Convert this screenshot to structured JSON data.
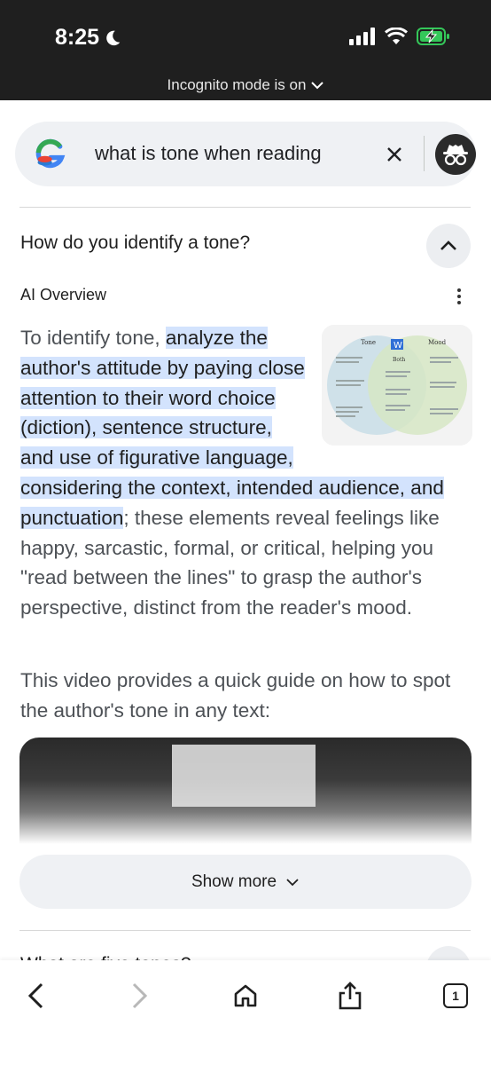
{
  "status_bar": {
    "time": "8:25"
  },
  "incognito": {
    "banner": "Incognito mode is on"
  },
  "search": {
    "query": "what is tone when reading"
  },
  "question": {
    "title": "How do you identify a tone?",
    "ai_label": "AI Overview"
  },
  "overview": {
    "intro": "To identify tone, ",
    "highlight": "analyze the author's attitude by paying close attention to their word choice (diction), sentence structure, and use of figurative language, considering the context, intended audience, and punctuation",
    "rest": "; these elements reveal feelings like happy, sarcastic, formal, or critical, helping you \"read between the lines\" to grasp the author's perspective, distinct from the reader's mood.",
    "video_intro": "This video provides a quick guide on how to spot the author's tone in any text:"
  },
  "venn": {
    "left": "Tone",
    "center": "Both",
    "right": "Mood",
    "badge": "W"
  },
  "show_more": {
    "label": "Show more"
  },
  "next_question": {
    "title": "What are five tones?"
  },
  "bottom_nav": {
    "tab_count": "1"
  },
  "colors": {
    "highlight": "#d3e3fd",
    "header_bg": "#1f1f1f",
    "pill_bg": "#eff1f4"
  }
}
